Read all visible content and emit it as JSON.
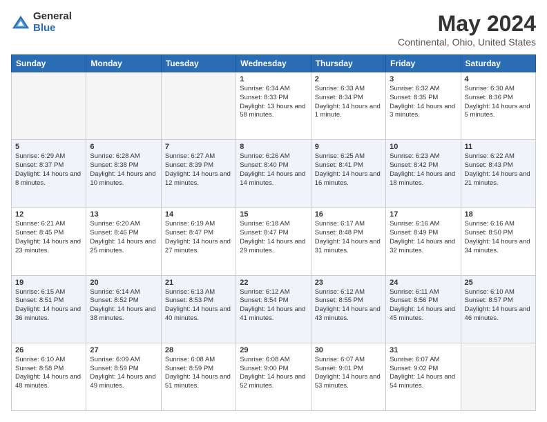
{
  "logo": {
    "general": "General",
    "blue": "Blue"
  },
  "title": "May 2024",
  "subtitle": "Continental, Ohio, United States",
  "weekdays": [
    "Sunday",
    "Monday",
    "Tuesday",
    "Wednesday",
    "Thursday",
    "Friday",
    "Saturday"
  ],
  "weeks": [
    [
      {
        "day": "",
        "empty": true
      },
      {
        "day": "",
        "empty": true
      },
      {
        "day": "",
        "empty": true
      },
      {
        "day": "1",
        "sunrise": "6:34 AM",
        "sunset": "8:33 PM",
        "daylight": "13 hours and 58 minutes."
      },
      {
        "day": "2",
        "sunrise": "6:33 AM",
        "sunset": "8:34 PM",
        "daylight": "14 hours and 1 minute."
      },
      {
        "day": "3",
        "sunrise": "6:32 AM",
        "sunset": "8:35 PM",
        "daylight": "14 hours and 3 minutes."
      },
      {
        "day": "4",
        "sunrise": "6:30 AM",
        "sunset": "8:36 PM",
        "daylight": "14 hours and 5 minutes."
      }
    ],
    [
      {
        "day": "5",
        "sunrise": "6:29 AM",
        "sunset": "8:37 PM",
        "daylight": "14 hours and 8 minutes."
      },
      {
        "day": "6",
        "sunrise": "6:28 AM",
        "sunset": "8:38 PM",
        "daylight": "14 hours and 10 minutes."
      },
      {
        "day": "7",
        "sunrise": "6:27 AM",
        "sunset": "8:39 PM",
        "daylight": "14 hours and 12 minutes."
      },
      {
        "day": "8",
        "sunrise": "6:26 AM",
        "sunset": "8:40 PM",
        "daylight": "14 hours and 14 minutes."
      },
      {
        "day": "9",
        "sunrise": "6:25 AM",
        "sunset": "8:41 PM",
        "daylight": "14 hours and 16 minutes."
      },
      {
        "day": "10",
        "sunrise": "6:23 AM",
        "sunset": "8:42 PM",
        "daylight": "14 hours and 18 minutes."
      },
      {
        "day": "11",
        "sunrise": "6:22 AM",
        "sunset": "8:43 PM",
        "daylight": "14 hours and 21 minutes."
      }
    ],
    [
      {
        "day": "12",
        "sunrise": "6:21 AM",
        "sunset": "8:45 PM",
        "daylight": "14 hours and 23 minutes."
      },
      {
        "day": "13",
        "sunrise": "6:20 AM",
        "sunset": "8:46 PM",
        "daylight": "14 hours and 25 minutes."
      },
      {
        "day": "14",
        "sunrise": "6:19 AM",
        "sunset": "8:47 PM",
        "daylight": "14 hours and 27 minutes."
      },
      {
        "day": "15",
        "sunrise": "6:18 AM",
        "sunset": "8:47 PM",
        "daylight": "14 hours and 29 minutes."
      },
      {
        "day": "16",
        "sunrise": "6:17 AM",
        "sunset": "8:48 PM",
        "daylight": "14 hours and 31 minutes."
      },
      {
        "day": "17",
        "sunrise": "6:16 AM",
        "sunset": "8:49 PM",
        "daylight": "14 hours and 32 minutes."
      },
      {
        "day": "18",
        "sunrise": "6:16 AM",
        "sunset": "8:50 PM",
        "daylight": "14 hours and 34 minutes."
      }
    ],
    [
      {
        "day": "19",
        "sunrise": "6:15 AM",
        "sunset": "8:51 PM",
        "daylight": "14 hours and 36 minutes."
      },
      {
        "day": "20",
        "sunrise": "6:14 AM",
        "sunset": "8:52 PM",
        "daylight": "14 hours and 38 minutes."
      },
      {
        "day": "21",
        "sunrise": "6:13 AM",
        "sunset": "8:53 PM",
        "daylight": "14 hours and 40 minutes."
      },
      {
        "day": "22",
        "sunrise": "6:12 AM",
        "sunset": "8:54 PM",
        "daylight": "14 hours and 41 minutes."
      },
      {
        "day": "23",
        "sunrise": "6:12 AM",
        "sunset": "8:55 PM",
        "daylight": "14 hours and 43 minutes."
      },
      {
        "day": "24",
        "sunrise": "6:11 AM",
        "sunset": "8:56 PM",
        "daylight": "14 hours and 45 minutes."
      },
      {
        "day": "25",
        "sunrise": "6:10 AM",
        "sunset": "8:57 PM",
        "daylight": "14 hours and 46 minutes."
      }
    ],
    [
      {
        "day": "26",
        "sunrise": "6:10 AM",
        "sunset": "8:58 PM",
        "daylight": "14 hours and 48 minutes."
      },
      {
        "day": "27",
        "sunrise": "6:09 AM",
        "sunset": "8:59 PM",
        "daylight": "14 hours and 49 minutes."
      },
      {
        "day": "28",
        "sunrise": "6:08 AM",
        "sunset": "8:59 PM",
        "daylight": "14 hours and 51 minutes."
      },
      {
        "day": "29",
        "sunrise": "6:08 AM",
        "sunset": "9:00 PM",
        "daylight": "14 hours and 52 minutes."
      },
      {
        "day": "30",
        "sunrise": "6:07 AM",
        "sunset": "9:01 PM",
        "daylight": "14 hours and 53 minutes."
      },
      {
        "day": "31",
        "sunrise": "6:07 AM",
        "sunset": "9:02 PM",
        "daylight": "14 hours and 54 minutes."
      },
      {
        "day": "",
        "empty": true
      }
    ]
  ],
  "labels": {
    "sunrise": "Sunrise:",
    "sunset": "Sunset:",
    "daylight": "Daylight:"
  }
}
